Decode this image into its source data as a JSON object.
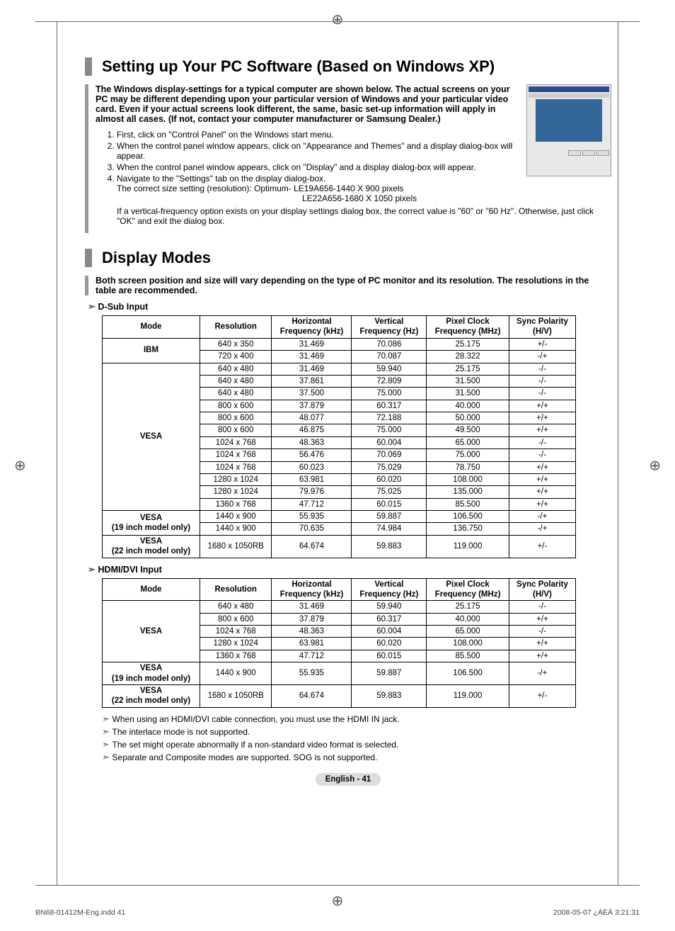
{
  "section1": {
    "title": "Setting up Your PC Software (Based on Windows XP)",
    "intro": "The Windows display-settings for a typical computer are shown below. The actual screens on your PC may be different depending upon your particular version of Windows and your particular video card. Even if your actual screens look different, the same, basic set-up information will apply in almost all cases. (If not, contact your computer manufacturer or Samsung Dealer.)",
    "steps": [
      "First, click on \"Control Panel\" on the Windows start menu.",
      "When the control panel window appears, click on \"Appearance and Themes\" and a display dialog-box will appear.",
      "When the control panel window appears, click on \"Display\" and a display dialog-box will appear.",
      "Navigate to the \"Settings\" tab on the display dialog-box."
    ],
    "res_line1": "The correct size setting (resolution): Optimum- LE19A656-1440 X 900 pixels",
    "res_line2": "LE22A656-1680 X 1050 pixels",
    "freq_note": "If a vertical-frequency option exists on your display settings dialog box, the correct value is \"60\" or \"60 Hz\". Otherwise, just click \"OK\" and exit the dialog box."
  },
  "section2": {
    "title": "Display Modes",
    "intro": "Both screen position and size will vary depending on the type of PC monitor and its resolution. The resolutions in the table are recommended.",
    "dsub_label": "D-Sub Input",
    "hdmi_label": "HDMI/DVI Input",
    "headers": [
      "Mode",
      "Resolution",
      "Horizontal Frequency (kHz)",
      "Vertical Frequency (Hz)",
      "Pixel Clock Frequency (MHz)",
      "Sync Polarity (H/V)"
    ],
    "dsub_groups": [
      {
        "mode": "IBM",
        "rows": [
          [
            "640 x 350",
            "31.469",
            "70.086",
            "25.175",
            "+/-"
          ],
          [
            "720 x 400",
            "31.469",
            "70.087",
            "28.322",
            "-/+"
          ]
        ]
      },
      {
        "mode": "VESA",
        "rows": [
          [
            "640 x 480",
            "31.469",
            "59.940",
            "25.175",
            "-/-"
          ],
          [
            "640 x 480",
            "37.861",
            "72.809",
            "31.500",
            "-/-"
          ],
          [
            "640 x 480",
            "37.500",
            "75.000",
            "31.500",
            "-/-"
          ],
          [
            "800 x 600",
            "37.879",
            "60.317",
            "40.000",
            "+/+"
          ],
          [
            "800 x 600",
            "48.077",
            "72.188",
            "50.000",
            "+/+"
          ],
          [
            "800 x 600",
            "46.875",
            "75.000",
            "49.500",
            "+/+"
          ],
          [
            "1024 x 768",
            "48.363",
            "60.004",
            "65.000",
            "-/-"
          ],
          [
            "1024 x 768",
            "56.476",
            "70.069",
            "75.000",
            "-/-"
          ],
          [
            "1024 x 768",
            "60.023",
            "75.029",
            "78.750",
            "+/+"
          ],
          [
            "1280 x 1024",
            "63.981",
            "60.020",
            "108.000",
            "+/+"
          ],
          [
            "1280 x 1024",
            "79.976",
            "75.025",
            "135.000",
            "+/+"
          ],
          [
            "1360 x 768",
            "47.712",
            "60.015",
            "85.500",
            "+/+"
          ]
        ]
      },
      {
        "mode": "VESA (19 inch model only)",
        "rows": [
          [
            "1440 x 900",
            "55.935",
            "59.887",
            "106.500",
            "-/+"
          ],
          [
            "1440 x 900",
            "70.635",
            "74.984",
            "136.750",
            "-/+"
          ]
        ]
      },
      {
        "mode": "VESA (22 inch model only)",
        "rows": [
          [
            "1680 x 1050RB",
            "64.674",
            "59.883",
            "119.000",
            "+/-"
          ]
        ]
      }
    ],
    "hdmi_groups": [
      {
        "mode": "VESA",
        "rows": [
          [
            "640 x 480",
            "31.469",
            "59.940",
            "25.175",
            "-/-"
          ],
          [
            "800 x 600",
            "37.879",
            "60.317",
            "40.000",
            "+/+"
          ],
          [
            "1024 x 768",
            "48.363",
            "60.004",
            "65.000",
            "-/-"
          ],
          [
            "1280 x 1024",
            "63.981",
            "60.020",
            "108.000",
            "+/+"
          ],
          [
            "1360 x 768",
            "47.712",
            "60.015",
            "85.500",
            "+/+"
          ]
        ]
      },
      {
        "mode": "VESA (19 inch model only)",
        "rows": [
          [
            "1440 x 900",
            "55.935",
            "59.887",
            "106.500",
            "-/+"
          ]
        ]
      },
      {
        "mode": "VESA (22 inch model only)",
        "rows": [
          [
            "1680 x 1050RB",
            "64.674",
            "59.883",
            "119.000",
            "+/-"
          ]
        ]
      }
    ],
    "notes": [
      "When using an HDMI/DVI cable connection, you must use the HDMI IN jack.",
      "The interlace mode is not supported.",
      "The set might operate abnormally if a non-standard video format is selected.",
      "Separate and Composite modes are supported. SOG is not supported."
    ]
  },
  "page_label": "English - 41",
  "footer_left": "BN68-01412M-Eng.indd   41",
  "footer_right": "2008-05-07   ¿ÀÈÄ 3:21:31"
}
